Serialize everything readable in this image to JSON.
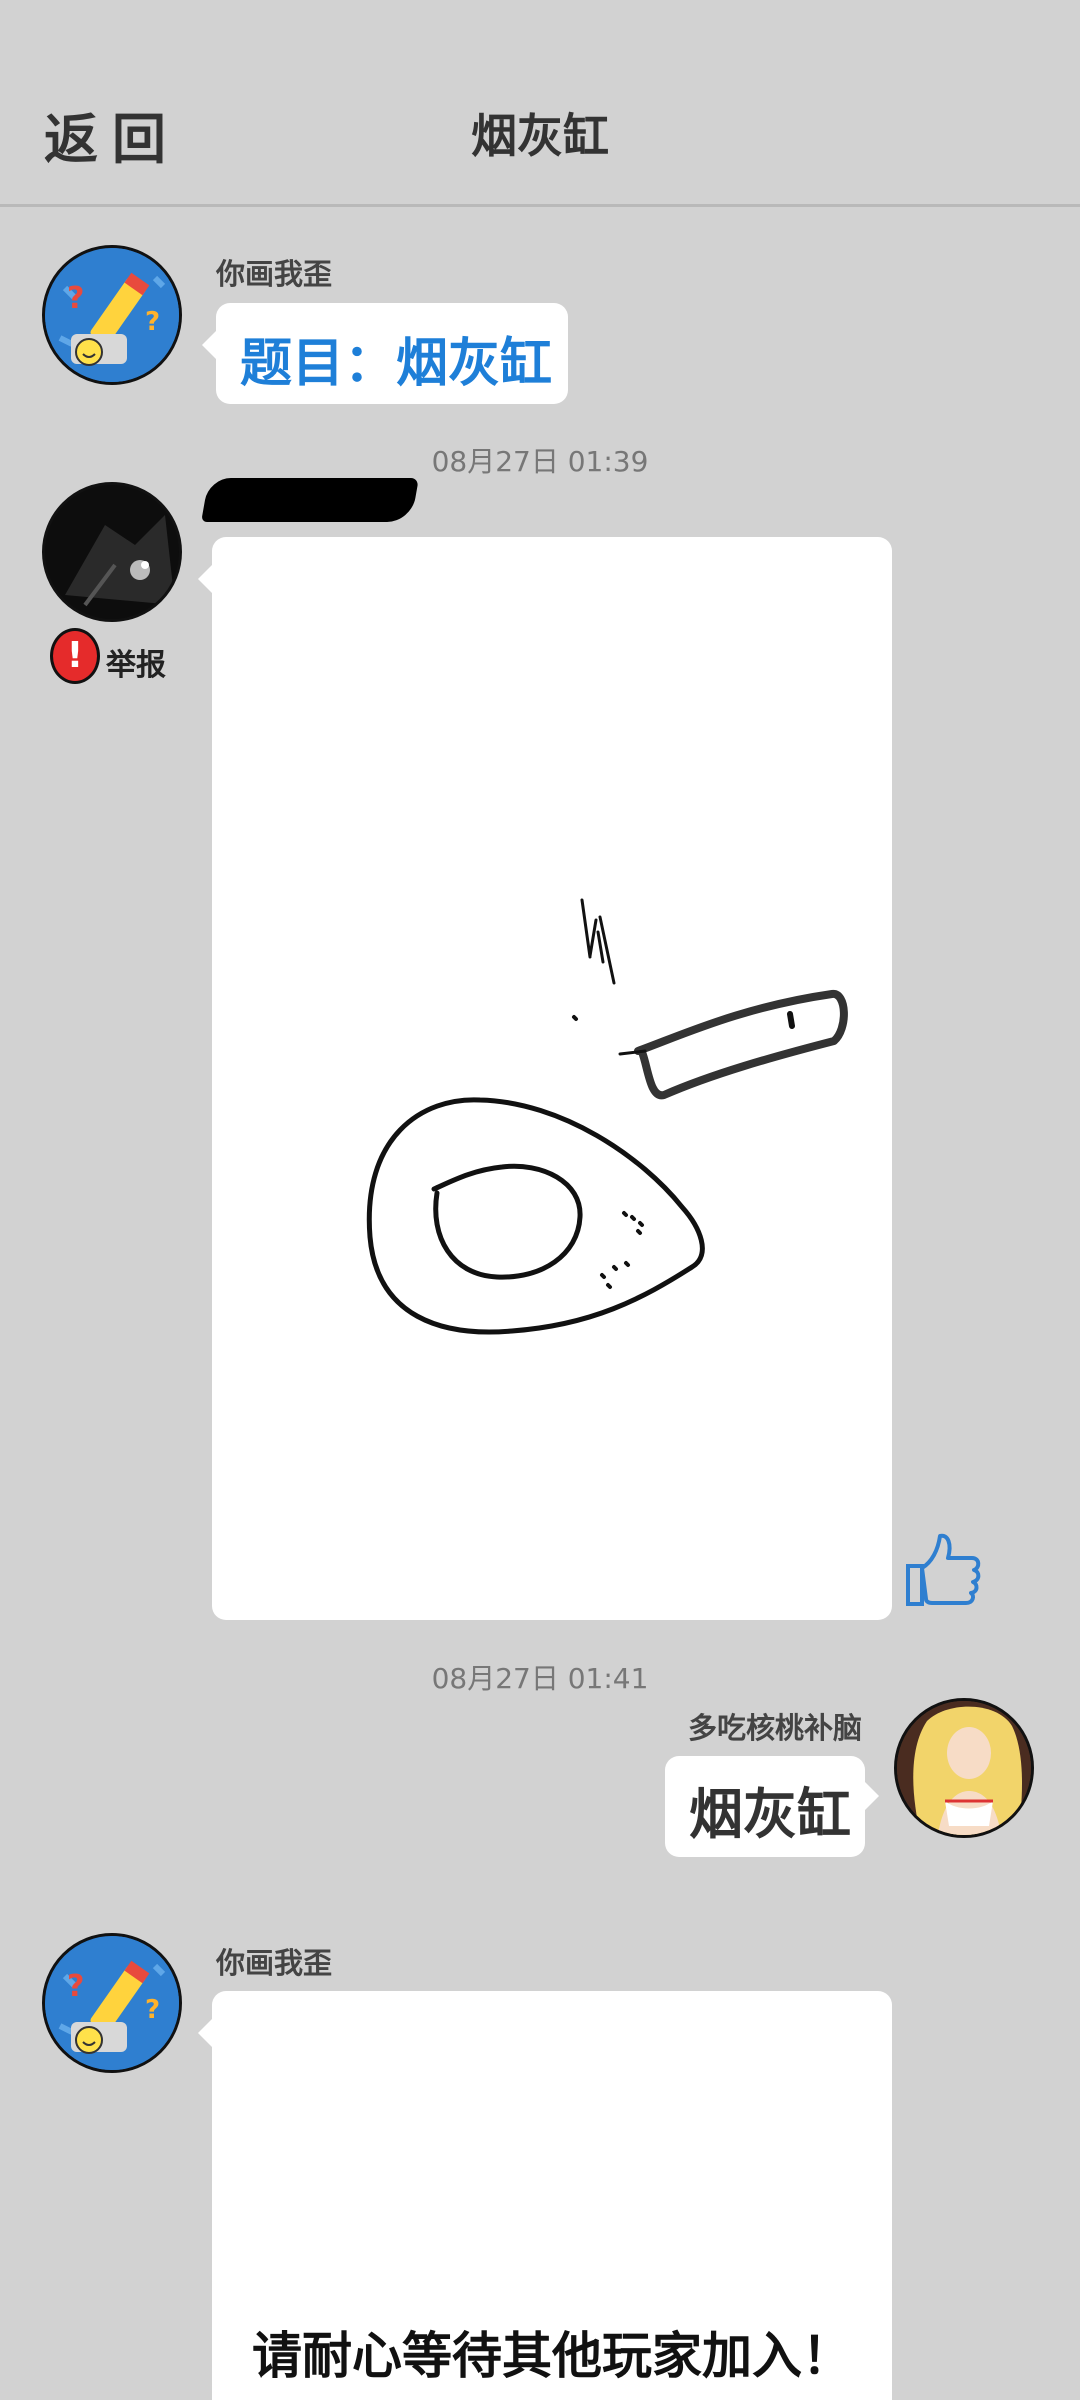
{
  "header": {
    "back_label": "返回",
    "title": "烟灰缸"
  },
  "messages": {
    "prompt": {
      "sender": "你画我歪",
      "text": "题目：烟灰缸"
    },
    "time1": "08月27日  01:39",
    "drawing": {
      "report_label": "举报",
      "report_icon": "exclamation-icon",
      "like_icon": "thumbs-up-icon"
    },
    "time2": "08月27日  01:41",
    "answer": {
      "sender": "多吃核桃补脑",
      "text": "烟灰缸"
    },
    "system": {
      "sender": "你画我歪",
      "text": "请耐心等待其他玩家加入！"
    }
  },
  "colors": {
    "background": "#d2d2d2",
    "prompt_blue": "#1e7fd8",
    "report_red": "#e52b2b"
  }
}
